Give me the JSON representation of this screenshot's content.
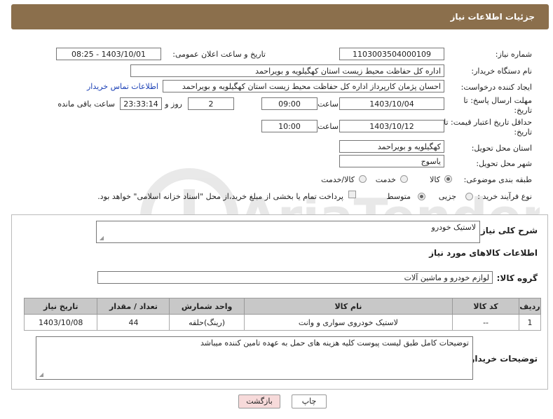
{
  "header": {
    "title": "جزئیات اطلاعات نیاز"
  },
  "form": {
    "need_number_label": "شماره نیاز:",
    "need_number": "1103003504000109",
    "announce_label": "تاریخ و ساعت اعلان عمومی:",
    "announce_value": "1403/10/01 - 08:25",
    "buyer_org_label": "نام دستگاه خریدار:",
    "buyer_org": "اداره کل حفاظت محیط زیست استان کهگیلویه و بویراحمد",
    "creator_label": "ایجاد کننده درخواست:",
    "creator": "احسان پژمان کارپرداز اداره کل حفاظت محیط زیست استان کهگیلویه و بویراحمد",
    "contact_link": "اطلاعات تماس خریدار",
    "deadline_label_1": "مهلت ارسال پاسخ: تا",
    "deadline_label_2": "تاریخ:",
    "deadline_date": "1403/10/04",
    "time_label": "ساعت",
    "deadline_time": "09:00",
    "days_value": "2",
    "days_label": "روز و",
    "remaining_time": "23:33:14",
    "remaining_label": "ساعت باقی مانده",
    "price_validity_label_1": "حداقل تاریخ اعتبار قیمت: تا",
    "price_validity_label_2": "تاریخ:",
    "price_validity_date": "1403/10/12",
    "price_validity_time": "10:00",
    "province_label": "استان محل تحویل:",
    "province": "کهگیلویه و بویراحمد",
    "city_label": "شهر محل تحویل:",
    "city": "یاسوج",
    "category_label": "طبقه بندی موضوعی:",
    "category_options": [
      "کالا",
      "خدمت",
      "کالا/خدمت"
    ],
    "process_label": "نوع فرآیند خرید :",
    "process_options": [
      "جزیی",
      "متوسط"
    ],
    "payment_note": "پرداخت تمام یا بخشی از مبلغ خرید،از محل \"اسناد خزانه اسلامی\" خواهد بود."
  },
  "details": {
    "general_desc_label": "شرح کلی نیاز:",
    "general_desc": "لاستیک خودرو",
    "goods_info_title": "اطلاعات کالاهای مورد نیاز",
    "goods_group_label": "گروه کالا:",
    "goods_group": "لوازم خودرو و ماشین آلات",
    "table": {
      "headers": [
        "ردیف",
        "کد کالا",
        "نام کالا",
        "واحد شمارش",
        "تعداد / مقدار",
        "تاریخ نیاز"
      ],
      "rows": [
        [
          "1",
          "--",
          "لاستیک خودروی سواری و وانت",
          "(رینگ)حلقه",
          "44",
          "1403/10/08"
        ]
      ]
    },
    "buyer_notes_label": "توضیحات خریدار:",
    "buyer_notes": "توضیحات کامل طبق لیست پیوست کلیه هزینه های حمل به عهده تامین کننده میباشد"
  },
  "buttons": {
    "print": "چاپ",
    "back": "بازگشت"
  },
  "watermark": {
    "text": "AriaTender.neT"
  },
  "colors": {
    "header": "#8b6f4c",
    "link": "#1a3fb5",
    "back_button": "#f7dada"
  }
}
